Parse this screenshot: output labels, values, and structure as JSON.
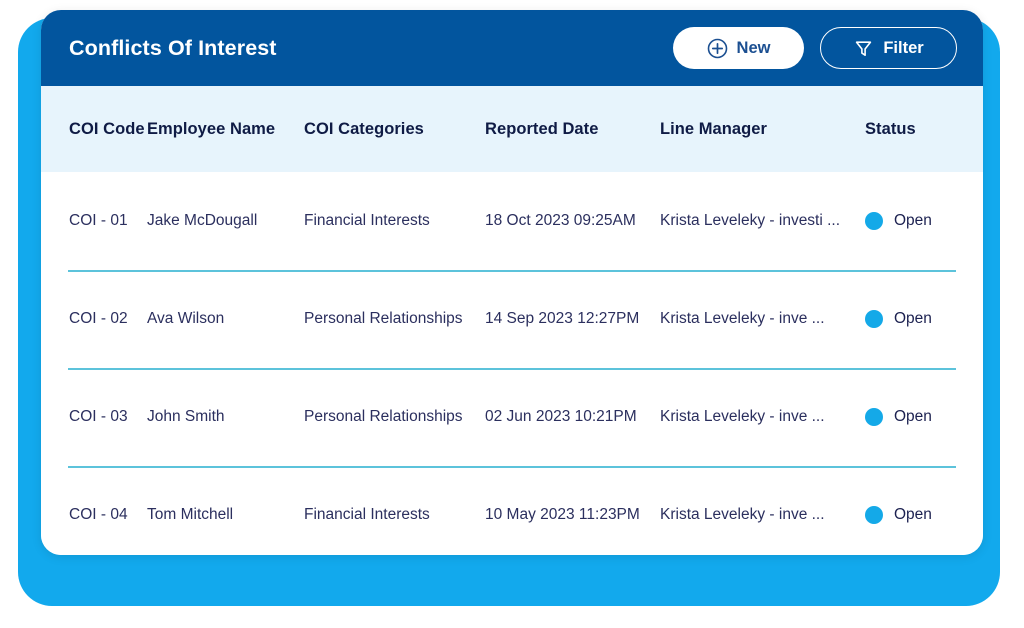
{
  "header": {
    "title": "Conflicts Of Interest",
    "new_button_label": "New",
    "filter_button_label": "Filter",
    "new_icon": "plus-circle-icon",
    "filter_icon": "funnel-icon"
  },
  "table": {
    "columns": [
      "COI Code",
      "Employee Name",
      "COI Categories",
      "Reported Date",
      "Line Manager",
      "Status"
    ],
    "rows": [
      {
        "coi_code": "COI - 01",
        "employee_name": "Jake McDougall",
        "coi_category": "Financial Interests",
        "reported_date": "18 Oct 2023 09:25AM",
        "line_manager": "Krista Leveleky - investi ...",
        "status": "Open"
      },
      {
        "coi_code": "COI - 02",
        "employee_name": "Ava Wilson",
        "coi_category": "Personal Relationships",
        "reported_date": "14 Sep 2023 12:27PM",
        "line_manager": "Krista Leveleky - inve ...",
        "status": "Open"
      },
      {
        "coi_code": "COI - 03",
        "employee_name": "John Smith",
        "coi_category": "Personal Relationships",
        "reported_date": "02 Jun 2023 10:21PM",
        "line_manager": "Krista Leveleky - inve ...",
        "status": "Open"
      },
      {
        "coi_code": "COI - 04",
        "employee_name": "Tom Mitchell",
        "coi_category": "Financial Interests",
        "reported_date": "10 May 2023 11:23PM",
        "line_manager": "Krista Leveleky - inve ...",
        "status": "Open"
      }
    ]
  },
  "colors": {
    "header_bar": "#02559E",
    "backdrop": "#12A9ED",
    "table_header_bg": "#E7F4FC",
    "row_divider": "#5CC3DB",
    "status_dot": "#14A9E8",
    "text_dark": "#2B2F5E"
  }
}
